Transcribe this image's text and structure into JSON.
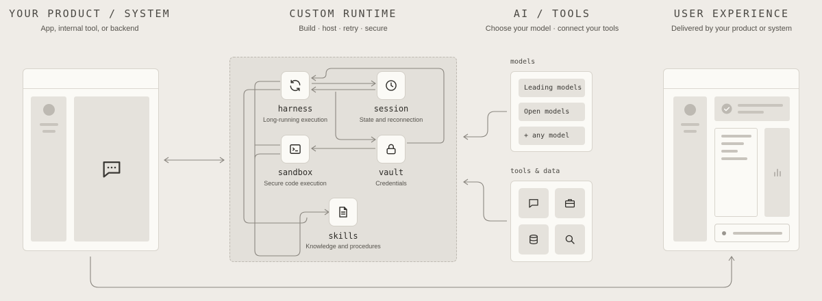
{
  "columns": [
    {
      "title": "YOUR PRODUCT / SYSTEM",
      "subtitle": "App, internal tool, or backend"
    },
    {
      "title": "CUSTOM RUNTIME",
      "subtitle": "Build · host · retry · secure"
    },
    {
      "title": "AI / TOOLS",
      "subtitle": "Choose your model · connect your tools"
    },
    {
      "title": "USER EXPERIENCE",
      "subtitle": "Delivered by your product or system"
    }
  ],
  "runtime_nodes": [
    {
      "name": "harness",
      "desc": "Long-running execution",
      "icon": "refresh-icon"
    },
    {
      "name": "session",
      "desc": "State and reconnection",
      "icon": "clock-icon"
    },
    {
      "name": "sandbox",
      "desc": "Secure code execution",
      "icon": "terminal-icon"
    },
    {
      "name": "vault",
      "desc": "Credentials",
      "icon": "lock-icon"
    },
    {
      "name": "skills",
      "desc": "Knowledge and procedures",
      "icon": "document-icon"
    }
  ],
  "models": {
    "label": "models",
    "items": [
      "Leading models",
      "Open models",
      "+ any model"
    ]
  },
  "tools": {
    "label": "tools & data",
    "icons": [
      "chat-icon",
      "briefcase-icon",
      "database-icon",
      "search-icon"
    ]
  },
  "colors": {
    "background": "#efece7",
    "panel": "#fbfaf6",
    "runtime_area": "#e3e0da",
    "line": "#8a867f"
  }
}
